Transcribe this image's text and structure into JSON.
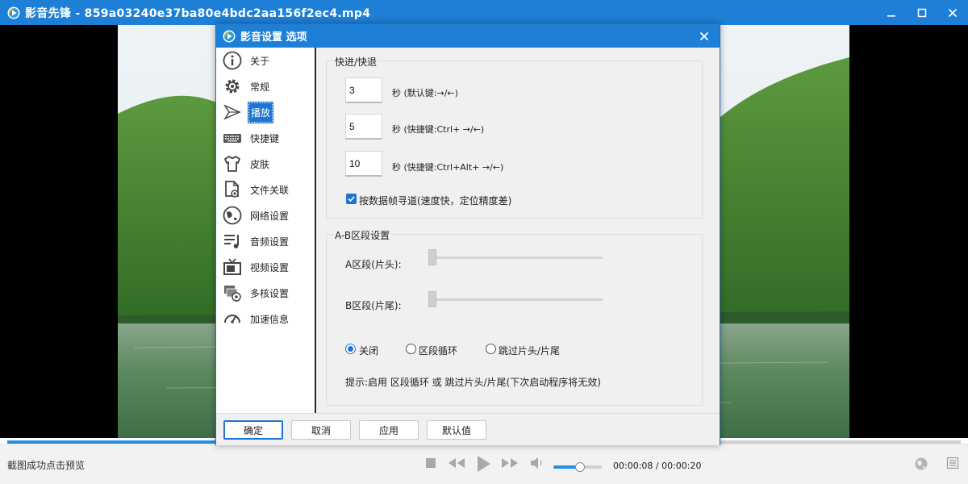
{
  "window": {
    "title": "影音先锋 - 859a03240e37ba80e4bdc2aa156f2ec4.mp4"
  },
  "dialog": {
    "title": "影音设置 选项",
    "nav": [
      {
        "label": "关于",
        "icon": "info-icon"
      },
      {
        "label": "常规",
        "icon": "gear-icon"
      },
      {
        "label": "播放",
        "icon": "play-arrow-icon",
        "active": true
      },
      {
        "label": "快捷键",
        "icon": "keyboard-icon"
      },
      {
        "label": "皮肤",
        "icon": "tshirt-icon"
      },
      {
        "label": "文件关联",
        "icon": "file-link-icon"
      },
      {
        "label": "网络设置",
        "icon": "network-icon"
      },
      {
        "label": "音频设置",
        "icon": "audio-icon"
      },
      {
        "label": "视频设置",
        "icon": "tv-icon"
      },
      {
        "label": "多核设置",
        "icon": "multicore-icon"
      },
      {
        "label": "加速信息",
        "icon": "speedometer-icon"
      }
    ],
    "seek_group": {
      "title": "快进/快退",
      "rows": [
        {
          "value": "3",
          "label": "秒 (默认键:→/←)"
        },
        {
          "value": "5",
          "label": "秒 (快捷键:Ctrl+ →/←)"
        },
        {
          "value": "10",
          "label": "秒 (快捷键:Ctrl+Alt+ →/←)"
        }
      ],
      "keyframe_checkbox": {
        "label": "按数据帧寻道(速度快，定位精度差)",
        "checked": true
      }
    },
    "ab_group": {
      "title": "A-B区段设置",
      "a_label": "A区段(片头):",
      "b_label": "B区段(片尾):",
      "a_value": 0,
      "b_value": 0,
      "radios": [
        {
          "label": "关闭",
          "checked": true
        },
        {
          "label": "区段循环",
          "checked": false
        },
        {
          "label": "跳过片头/片尾",
          "checked": false
        }
      ],
      "hint": "提示:启用 区段循环 或 跳过片头/片尾(下次启动程序将无效)"
    },
    "buttons": {
      "ok": "确定",
      "cancel": "取消",
      "apply": "应用",
      "default": "默认值"
    }
  },
  "player": {
    "status": "截图成功点击预览",
    "time": "00:00:08 / 00:00:20",
    "progress": 0.4,
    "volume": 0.55
  },
  "colors": {
    "accent": "#1e7fd6",
    "selection": "#1e74d2"
  }
}
